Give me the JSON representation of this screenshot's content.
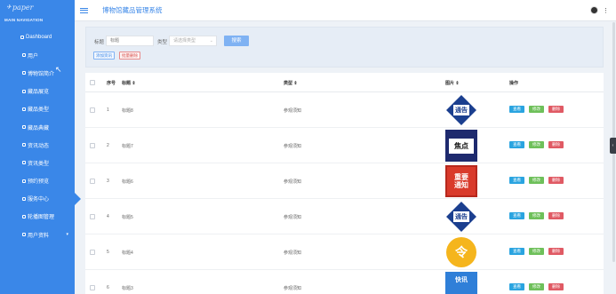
{
  "sidebar": {
    "logo": "paper",
    "nav_title": "MAIN NAVIGATION",
    "items": [
      {
        "label": "Dashboard"
      },
      {
        "label": "用户"
      },
      {
        "label": "博物馆简介"
      },
      {
        "label": "藏品展览"
      },
      {
        "label": "藏品类型"
      },
      {
        "label": "藏品典藏"
      },
      {
        "label": "资讯动态"
      },
      {
        "label": "资讯类型"
      },
      {
        "label": "预约预览"
      },
      {
        "label": "服务中心"
      },
      {
        "label": "轮播图管理"
      },
      {
        "label": "用户资料"
      }
    ]
  },
  "topbar": {
    "title": "博物馆藏品管理系统"
  },
  "filter": {
    "title_label": "标题",
    "title_placeholder": "标题",
    "type_label": "类型",
    "type_placeholder": "请选择类型",
    "search_label": "搜索",
    "add_label": "添加资讯",
    "batch_delete_label": "批量删除"
  },
  "table": {
    "headers": {
      "index": "序号",
      "title": "标题 ⇕",
      "type": "类型 ⇕",
      "image": "图片 ⇕",
      "ops": "操作"
    },
    "rows": [
      {
        "index": "1",
        "title": "标题8",
        "type": "参观须知",
        "image": "通告"
      },
      {
        "index": "2",
        "title": "标题7",
        "type": "参观须知",
        "image": "焦点"
      },
      {
        "index": "3",
        "title": "标题6",
        "type": "参观须知",
        "image_line1": "重要",
        "image_line2": "通知"
      },
      {
        "index": "4",
        "title": "标题5",
        "type": "参观须知",
        "image": "通告"
      },
      {
        "index": "5",
        "title": "标题4",
        "type": "参观须知",
        "image": "令"
      },
      {
        "index": "6",
        "title": "标题3",
        "type": "参观须知",
        "image": "快讯"
      }
    ],
    "ops": {
      "view": "查看",
      "edit": "修改",
      "delete": "删除"
    }
  }
}
